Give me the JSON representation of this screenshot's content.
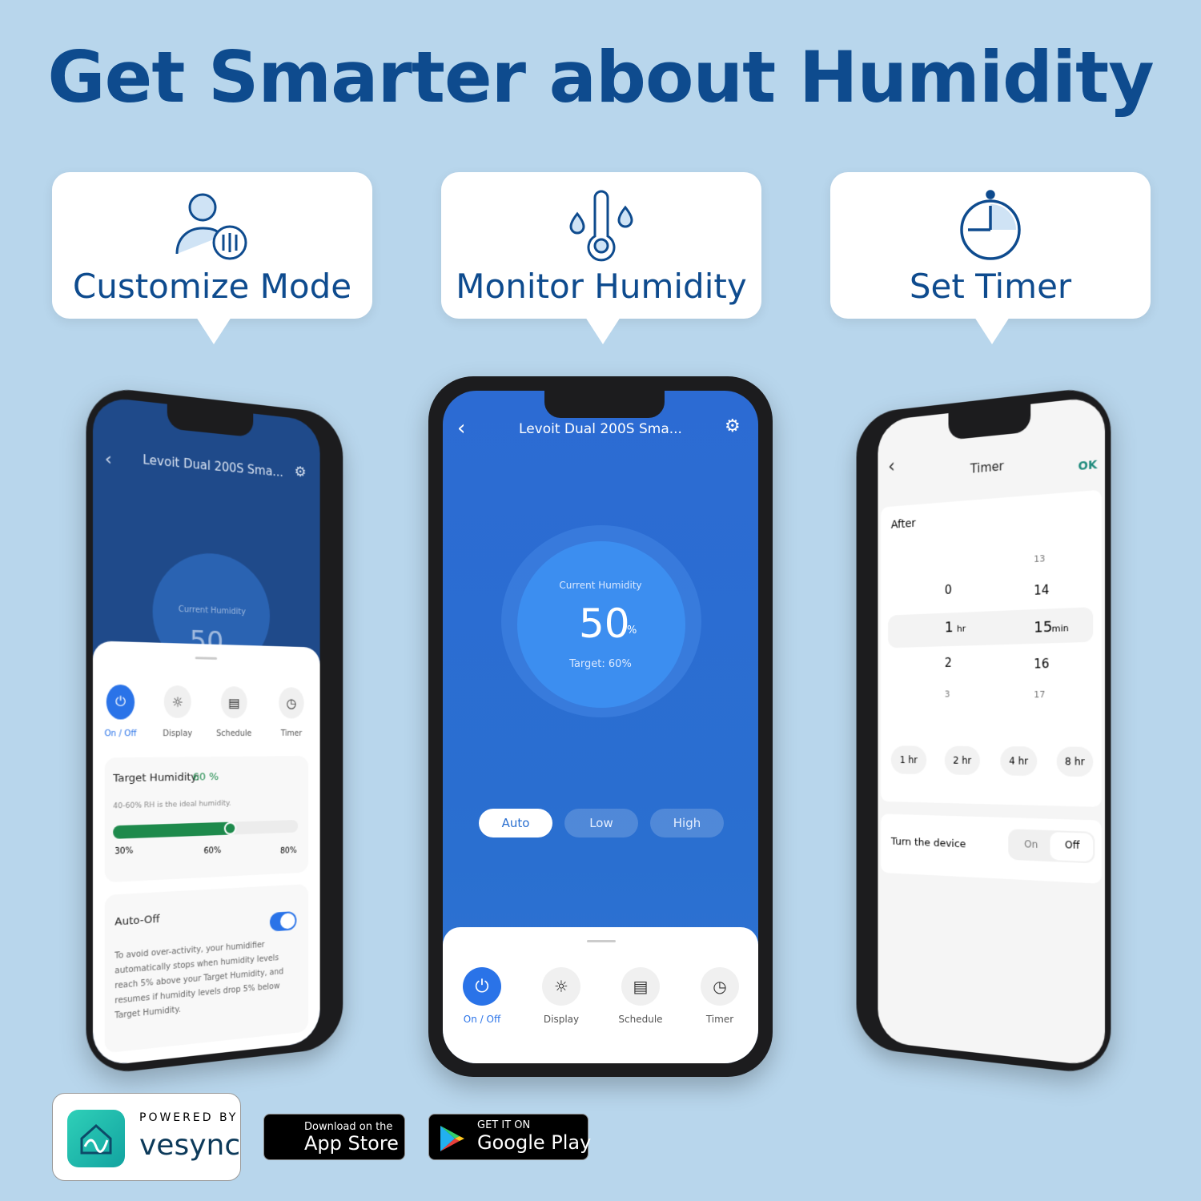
{
  "title": "Get Smarter about Humidity",
  "features": [
    {
      "label": "Customize Mode",
      "icon": "user-gear-icon"
    },
    {
      "label": "Monitor Humidity",
      "icon": "thermometer-drops-icon"
    },
    {
      "label": "Set Timer",
      "icon": "timer-icon"
    }
  ],
  "device_name": "Levoit Dual 200S Sma...",
  "controls": [
    {
      "label": "On / Off",
      "icon": "power-icon"
    },
    {
      "label": "Display",
      "icon": "display-icon"
    },
    {
      "label": "Schedule",
      "icon": "schedule-icon"
    },
    {
      "label": "Timer",
      "icon": "timer-icon"
    }
  ],
  "left_phone": {
    "current_humidity_label": "Current Humidity",
    "current_value": "50",
    "target_label": "Target Humidity:",
    "target_value": "60 %",
    "target_percent": 60,
    "hint": "40-60% RH is the ideal humidity.",
    "slider_ticks": [
      "30%",
      "60%",
      "80%"
    ],
    "auto_off_label": "Auto-Off",
    "auto_off_enabled": true,
    "auto_off_text": "To avoid over-activity, your humidifier automatically stops when humidity levels reach 5% above your Target Humidity, and resumes if humidity levels drop 5% below Target Humidity."
  },
  "center_phone": {
    "current_humidity_label": "Current Humidity",
    "value": "50",
    "unit": "%",
    "target": "Target: 60%",
    "modes": [
      "Auto",
      "Low",
      "High"
    ],
    "selected_mode": "Auto"
  },
  "right_phone": {
    "title": "Timer",
    "ok": "OK",
    "after": "After",
    "hours": [
      "0",
      "1",
      "2",
      "3"
    ],
    "hour_unit": "hr",
    "selected_hour": "1",
    "minutes": [
      "13",
      "14",
      "15",
      "16",
      "17"
    ],
    "minute_unit": "min",
    "selected_minute": "15",
    "presets": [
      "1 hr",
      "2 hr",
      "4 hr",
      "8 hr"
    ],
    "turn_label": "Turn the device",
    "turn_options": [
      "On",
      "Off"
    ],
    "turn_selected": "Off"
  },
  "footer": {
    "powered_by": "POWERED BY",
    "brand": "vesync",
    "app_store_small": "Download on the",
    "app_store_big": "App Store",
    "google_small": "GET IT ON",
    "google_big": "Google Play"
  },
  "colors": {
    "background": "#b8d6ec",
    "title": "#0e4b8e",
    "app_blue": "#2a6fd0",
    "accent_green": "#1e8a4c"
  }
}
